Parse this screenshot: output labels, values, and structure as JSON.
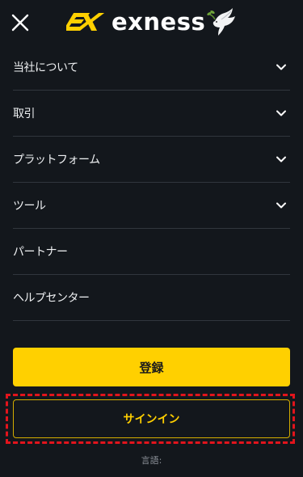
{
  "header": {
    "logo_text": "exness",
    "close_icon": "close-icon",
    "logo_mark_color": "#ffd000",
    "dove_icon": "dove-with-olive-branch-icon"
  },
  "menu": {
    "items": [
      {
        "label": "当社について",
        "has_chevron": true
      },
      {
        "label": "取引",
        "has_chevron": true
      },
      {
        "label": "プラットフォーム",
        "has_chevron": true
      },
      {
        "label": "ツール",
        "has_chevron": true
      },
      {
        "label": "パートナー",
        "has_chevron": false
      },
      {
        "label": "ヘルプセンター",
        "has_chevron": false
      }
    ]
  },
  "actions": {
    "register_label": "登録",
    "signin_label": "サインイン",
    "accent_color": "#ffd000",
    "highlight_color": "#e2141c"
  },
  "footer": {
    "language_label": "言語:"
  }
}
